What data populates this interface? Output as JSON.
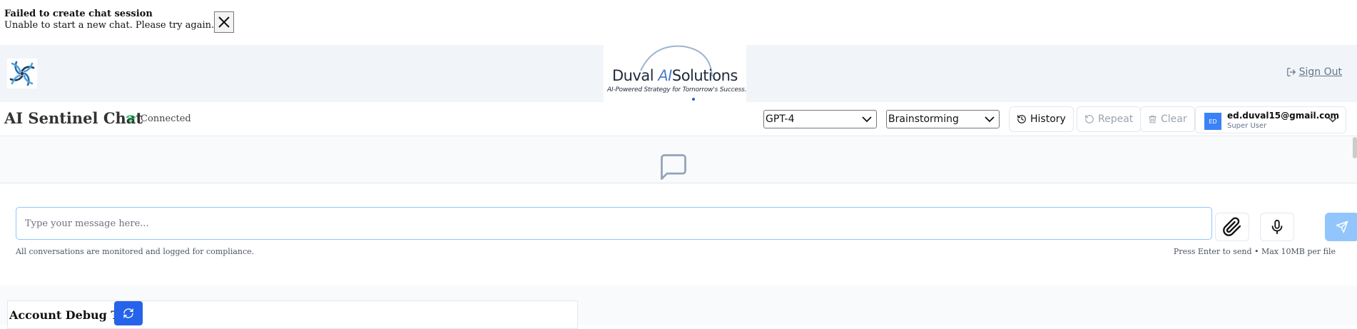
{
  "toast": {
    "title": "Failed to create chat session",
    "message": "Unable to start a new chat. Please try again."
  },
  "header": {
    "brand": {
      "name_part1": "Duv",
      "name_part2": "al ",
      "name_ai": "AI",
      "name_part3": "Solutions",
      "tagline": "AI-Powered Strategy for Tomorrow's Success."
    },
    "sign_out": "Sign Out"
  },
  "toolbar": {
    "title": "AI Sentinel Chat",
    "status": "Connected",
    "model_select": "GPT-4",
    "mode_select": "Brainstorming",
    "history": "History",
    "repeat": "Repeat",
    "clear": "Clear"
  },
  "user": {
    "initials": "ED",
    "email": "ed.duval15@gmail.com",
    "role": "Super User"
  },
  "composer": {
    "placeholder": "Type your message here...",
    "compliance_note": "All conversations are monitored and logged for compliance.",
    "hint": "Press Enter to send • Max 10MB per file"
  },
  "debug": {
    "title": "Account Debug Tool"
  },
  "colors": {
    "accent": "#2563eb",
    "send_disabled": "#93c5fd",
    "connected": "#22c55e",
    "header_bg": "#f1f5f9"
  },
  "icons": {
    "close": "x-icon",
    "status": "wifi-icon",
    "history": "history-icon",
    "repeat": "rotate-ccw-icon",
    "clear": "trash-icon",
    "attach": "paperclip-icon",
    "mic": "microphone-icon",
    "send": "send-icon",
    "empty": "message-square-icon",
    "signout": "logout-icon",
    "refresh": "refresh-icon"
  }
}
